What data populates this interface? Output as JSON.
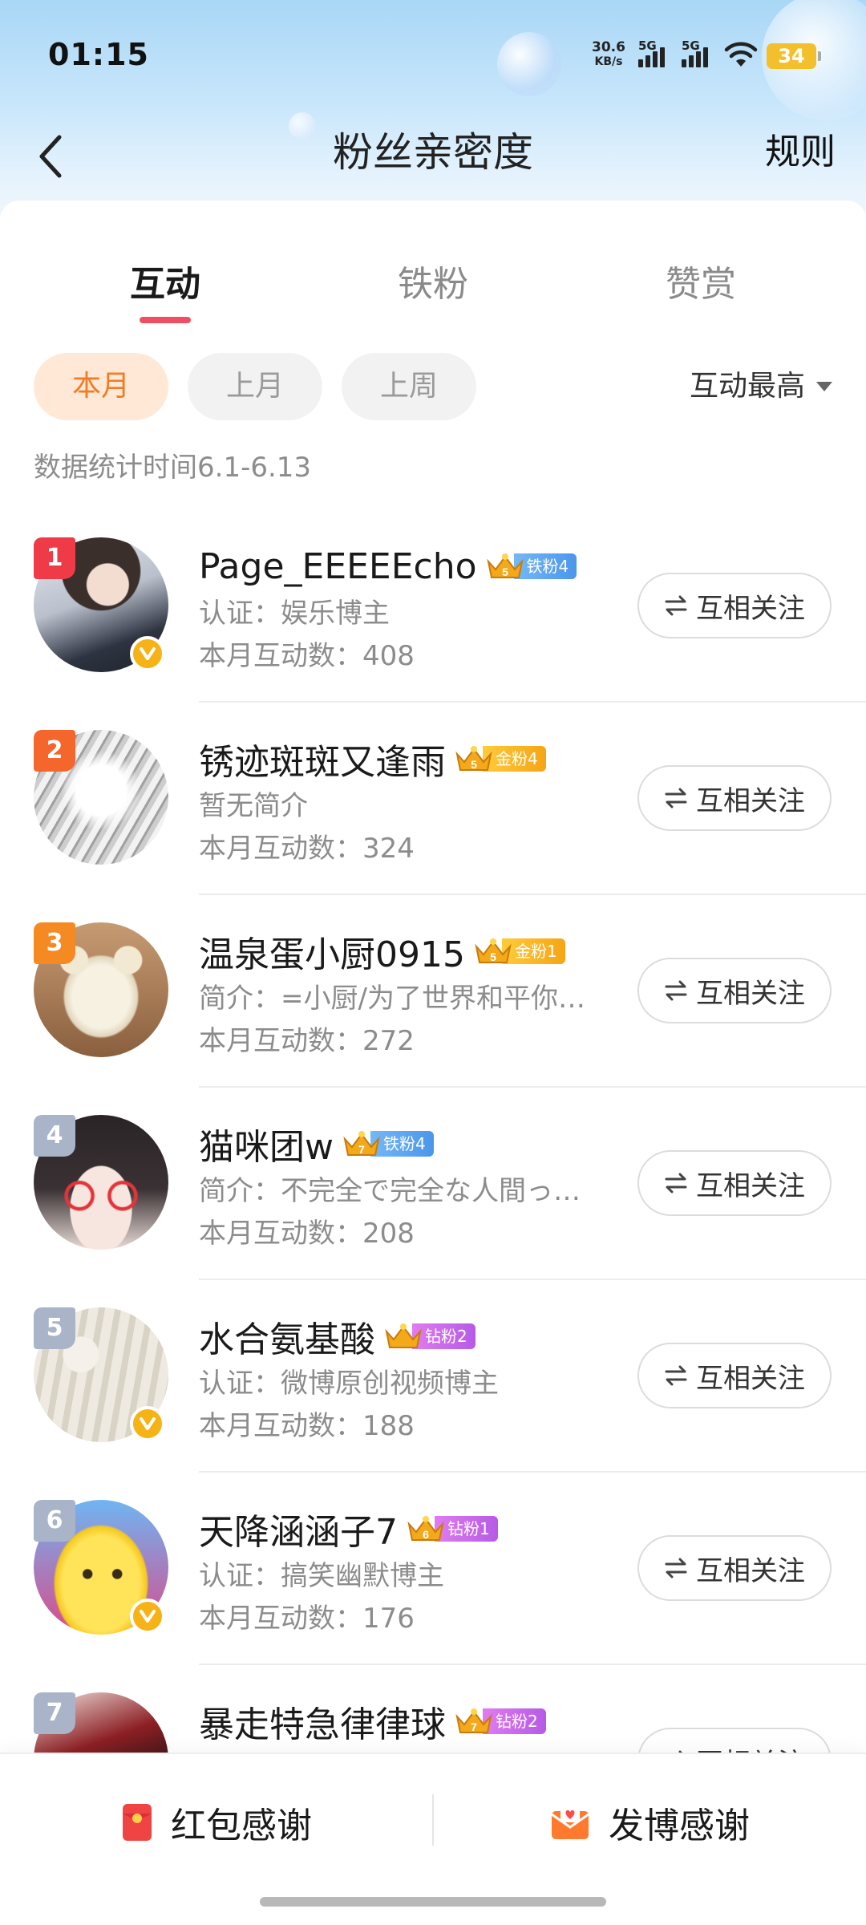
{
  "status_bar": {
    "time": "01:15",
    "net_speed_value": "30.6",
    "net_speed_unit": "KB/s",
    "signal_1_label": "5G",
    "signal_2_label": "5G",
    "battery": "34"
  },
  "nav": {
    "back_icon": "chevron-left-icon",
    "title": "粉丝亲密度",
    "rules_label": "规则"
  },
  "tabs": [
    {
      "label": "互动",
      "active": true
    },
    {
      "label": "铁粉",
      "active": false
    },
    {
      "label": "赞赏",
      "active": false
    }
  ],
  "filters": {
    "chips": [
      {
        "label": "本月",
        "active": true
      },
      {
        "label": "上月",
        "active": false
      },
      {
        "label": "上周",
        "active": false
      }
    ],
    "sort_label": "互动最高",
    "sort_icon": "caret-down-icon"
  },
  "stats_period": "数据统计时间6.1-6.13",
  "colors": {
    "accent_red": "#f04e62",
    "chip_active_bg": "#ffe9d6",
    "chip_active_text": "#f07c26",
    "rank_1": "#ef3a48",
    "rank_2": "#f5662d",
    "rank_3": "#f58a23",
    "rank_other": "#a9b4c8",
    "verified": "#f6b318"
  },
  "fans": [
    {
      "rank": "1",
      "name": "Page_EEEEEcho",
      "level": "5",
      "badge": "铁粉4",
      "badge_type": "iron",
      "bio": "认证：娱乐博主",
      "count": "本月互动数：408",
      "verified": true,
      "follow": "互相关注"
    },
    {
      "rank": "2",
      "name": "锈迹斑斑又逢雨",
      "level": "5",
      "badge": "金粉4",
      "badge_type": "gold",
      "bio": "暂无简介",
      "count": "本月互动数：324",
      "verified": false,
      "follow": "互相关注"
    },
    {
      "rank": "3",
      "name": "温泉蛋小厨0915",
      "level": "5",
      "badge": "金粉1",
      "badge_type": "gold",
      "bio": "简介：=小厨/为了世界和平你…",
      "count": "本月互动数：272",
      "verified": false,
      "follow": "互相关注"
    },
    {
      "rank": "4",
      "name": "猫咪团w",
      "level": "7",
      "badge": "铁粉4",
      "badge_type": "iron",
      "bio": "简介：不完全で完全な人間っ…",
      "count": "本月互动数：208",
      "verified": false,
      "follow": "互相关注"
    },
    {
      "rank": "5",
      "name": "水合氨基酸",
      "level": "",
      "badge": "钻粉2",
      "badge_type": "diamond",
      "bio": "认证：微博原创视频博主",
      "count": "本月互动数：188",
      "verified": true,
      "follow": "互相关注"
    },
    {
      "rank": "6",
      "name": "天降涵涵子7",
      "level": "6",
      "badge": "钻粉1",
      "badge_type": "diamond",
      "bio": "认证：搞笑幽默博主",
      "count": "本月互动数：176",
      "verified": true,
      "follow": "互相关注"
    },
    {
      "rank": "7",
      "name": "暴走特急律律球",
      "level": "7",
      "badge": "钻粉2",
      "badge_type": "diamond",
      "bio": "",
      "count": "",
      "verified": false,
      "follow": "互相关注"
    }
  ],
  "bottom": {
    "red_packet_label": "红包感谢",
    "red_packet_icon": "red-envelope-icon",
    "post_label": "发博感谢",
    "post_icon": "mail-heart-icon"
  }
}
